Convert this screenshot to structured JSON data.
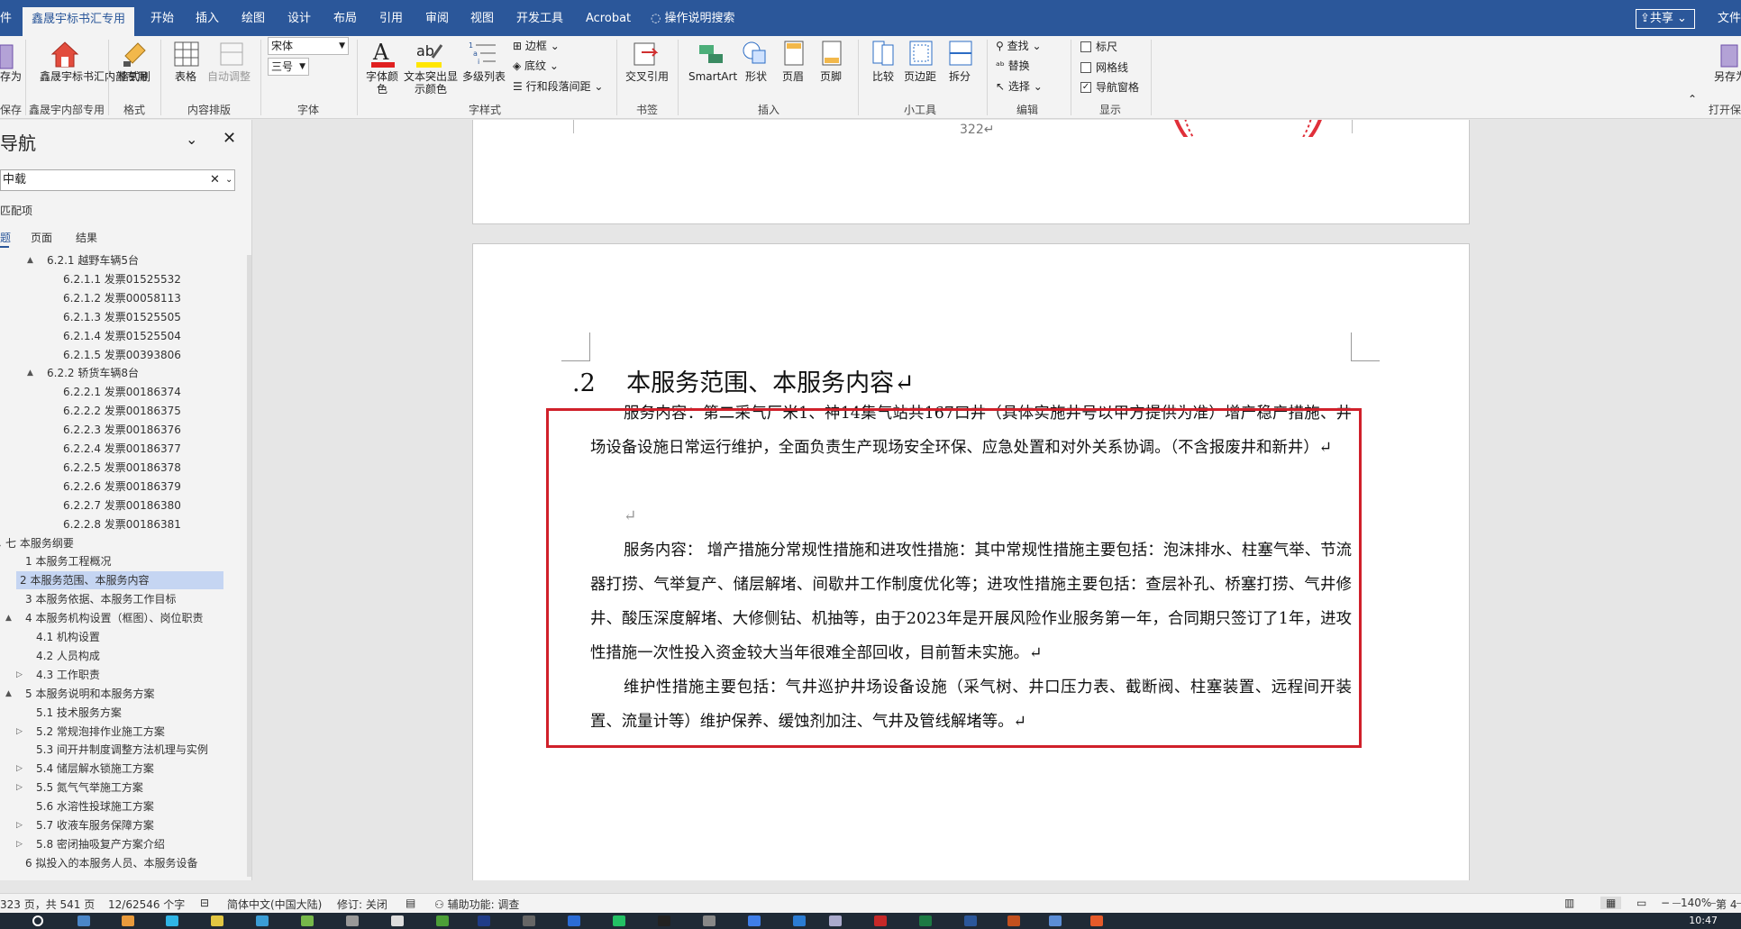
{
  "ribbon_tabs": {
    "file_partial": "件",
    "active": "鑫晟宇标书汇专用",
    "items": [
      "开始",
      "插入",
      "绘图",
      "设计",
      "布局",
      "引用",
      "审阅",
      "视图",
      "开发工具",
      "Acrobat"
    ],
    "tell_me": "操作说明搜索",
    "share": "共享",
    "file_right": "文件"
  },
  "ribbon": {
    "save_as_partial": "存为",
    "save_group": "保存",
    "xsy_btn": "鑫晟宇标书汇内部专用",
    "xsy_group": "鑫晟宇内部专用",
    "format_painter": "格式刷",
    "format_group": "格式",
    "table_btn": "表格",
    "auto_adjust": "自动调整",
    "content_group": "内容排版",
    "font_name": "宋体",
    "font_size": "三号",
    "font_group": "字体",
    "font_color": "字体颜色",
    "highlight": "文本突出显示颜色",
    "multilevel": "多级列表",
    "border": "边框",
    "shading": "底纹",
    "line_spacing": "行和段落间距",
    "style_group": "字样式",
    "cross_ref": "交叉引用",
    "bookmark_group": "书签",
    "smartart": "SmartArt",
    "shape": "形状",
    "header": "页眉",
    "footer": "页脚",
    "insert_group": "插入",
    "compare": "比较",
    "margins": "页边距",
    "split": "拆分",
    "tools_group": "小工具",
    "find": "查找",
    "replace": "替换",
    "select": "选择",
    "edit_group": "编辑",
    "ruler": "标尺",
    "gridlines": "网格线",
    "nav_pane": "导航窗格",
    "show_group": "显示",
    "save_as_right": "另存为",
    "print_partial": "打开保"
  },
  "nav": {
    "title": "导航",
    "search_value": "中载",
    "matches": "匹配项",
    "tabs": [
      "题",
      "页面",
      "结果"
    ],
    "items": [
      {
        "level": 3,
        "text": "6.2.1 越野车辆5台",
        "arrow": "▲"
      },
      {
        "level": 4,
        "text": "6.2.1.1 发票01525532"
      },
      {
        "level": 4,
        "text": "6.2.1.2 发票00058113"
      },
      {
        "level": 4,
        "text": "6.2.1.3 发票01525505"
      },
      {
        "level": 4,
        "text": "6.2.1.4 发票01525504"
      },
      {
        "level": 4,
        "text": "6.2.1.5 发票00393806"
      },
      {
        "level": 3,
        "text": "6.2.2 轿货车辆8台",
        "arrow": "▲"
      },
      {
        "level": 4,
        "text": "6.2.2.1 发票00186374"
      },
      {
        "level": 4,
        "text": "6.2.2.2 发票00186375"
      },
      {
        "level": 4,
        "text": "6.2.2.3 发票00186376"
      },
      {
        "level": 4,
        "text": "6.2.2.4 发票00186377"
      },
      {
        "level": 4,
        "text": "6.2.2.5 发票00186378"
      },
      {
        "level": 4,
        "text": "6.2.2.6 发票00186379"
      },
      {
        "level": 4,
        "text": "6.2.2.7 发票00186380"
      },
      {
        "level": 4,
        "text": "6.2.2.8 发票00186381"
      },
      {
        "level": 0,
        "text": "七 本服务纲要",
        "arrow": "▲"
      },
      {
        "level": 1,
        "text": "1 本服务工程概况"
      },
      {
        "level": 1,
        "text": "2 本服务范围、本服务内容",
        "selected": true
      },
      {
        "level": 1,
        "text": "3 本服务依据、本服务工作目标"
      },
      {
        "level": 1,
        "text": "4 本服务机构设置（框图）、岗位职责",
        "arrow": "▲"
      },
      {
        "level": 2,
        "text": "4.1 机构设置"
      },
      {
        "level": 2,
        "text": "4.2 人员构成"
      },
      {
        "level": 2,
        "text": "4.3 工作职责",
        "arrow": "▷"
      },
      {
        "level": 1,
        "text": "5 本服务说明和本服务方案",
        "arrow": "▲"
      },
      {
        "level": 2,
        "text": "5.1 技术服务方案"
      },
      {
        "level": 2,
        "text": "5.2 常规泡排作业施工方案",
        "arrow": "▷"
      },
      {
        "level": 2,
        "text": "5.3 间开井制度调整方法机理与实例"
      },
      {
        "level": 2,
        "text": "5.4 储层解水锁施工方案",
        "arrow": "▷"
      },
      {
        "level": 2,
        "text": "5.5 氮气气举施工方案",
        "arrow": "▷"
      },
      {
        "level": 2,
        "text": "5.6 水溶性投球施工方案"
      },
      {
        "level": 2,
        "text": "5.7 收液车服务保障方案",
        "arrow": "▷"
      },
      {
        "level": 2,
        "text": "5.8 密闭抽吸复产方案介绍",
        "arrow": "▷"
      },
      {
        "level": 1,
        "text": "6 拟投入的本服务人员、本服务设备"
      }
    ]
  },
  "document": {
    "prev_page_number": "322↵",
    "heading_num": ".2",
    "heading_text": "本服务范围、本服务内容↵",
    "paragraphs": [
      "服务内容：第二采气厂米1、神14集气站共167口井（具体实施井号以甲方提供为准）增产稳产措施、井场设备设施日常运行维护，全面负责生产现场安全环保、应急处置和对外关系协调。（不含报废井和新井）↵",
      "↵",
      "服务内容：  增产措施分常规性措施和进攻性措施：其中常规性措施主要包括：泡沫排水、柱塞气举、节流器打捞、气举复产、储层解堵、间歇井工作制度优化等；进攻性措施主要包括：查层补孔、桥塞打捞、气井修井、酸压深度解堵、大修侧钻、机抽等，由于2023年是开展风险作业服务第一年，合同期只签订了1年，进攻性措施一次性投入资金较大当年很难全部回收，目前暂未实施。↵",
      "维护性措施主要包括：气井巡护井场设备设施（采气树、井口压力表、截断阀、柱塞装置、远程间开装置、流量计等）维护保养、缓蚀剂加注、气井及管线解堵等。↵"
    ]
  },
  "status": {
    "page": "323 页，共 541 页",
    "words": "12/62546 个字",
    "language": "简体中文(中国大陆)",
    "track": "修订: 关闭",
    "accessibility": "辅助功能: 调查",
    "zoom": "140%",
    "page_right": "第 4"
  },
  "taskbar": {
    "clock": "10:47"
  }
}
